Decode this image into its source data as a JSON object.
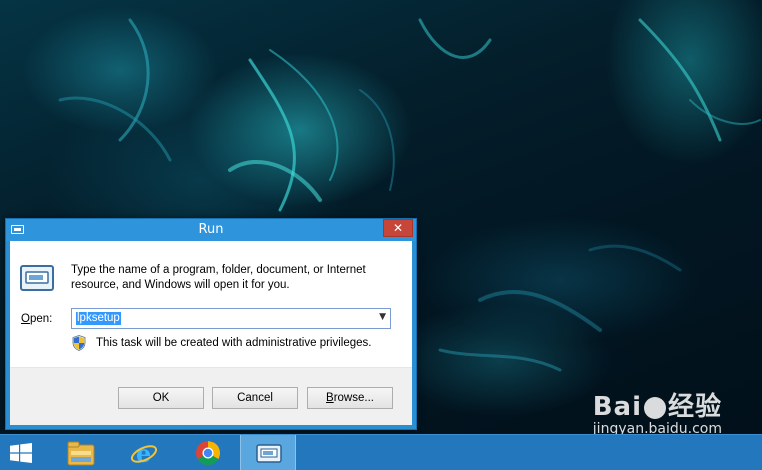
{
  "dialog": {
    "title": "Run",
    "close_glyph": "✕",
    "description": "Type the name of a program, folder, document, or Internet resource, and Windows will open it for you.",
    "open_label_accel": "O",
    "open_label_rest": "pen:",
    "input_value": "lpksetup",
    "privilege_note": "This task will be created with administrative privileges.",
    "buttons": {
      "ok": "OK",
      "cancel": "Cancel",
      "browse_accel": "B",
      "browse_rest": "rowse..."
    },
    "icons": {
      "title": "run-icon",
      "big": "run-icon",
      "shield": "uac-shield-icon",
      "dropdown": "chevron-down-icon"
    }
  },
  "taskbar": {
    "items": [
      {
        "name": "start",
        "icon": "windows-logo-icon"
      },
      {
        "name": "file-explorer",
        "icon": "folder-icon"
      },
      {
        "name": "internet-explorer",
        "icon": "ie-icon"
      },
      {
        "name": "chrome",
        "icon": "chrome-icon"
      },
      {
        "name": "run",
        "icon": "run-icon",
        "active": true
      }
    ]
  },
  "watermark": {
    "logo_left": "Bai",
    "logo_right": "经验",
    "url": "jingyan.baidu.com"
  },
  "colors": {
    "taskbar": "#2277bd",
    "dialog_frame": "#2a8ed3",
    "close_button": "#c7463a",
    "selection": "#3399ff"
  }
}
